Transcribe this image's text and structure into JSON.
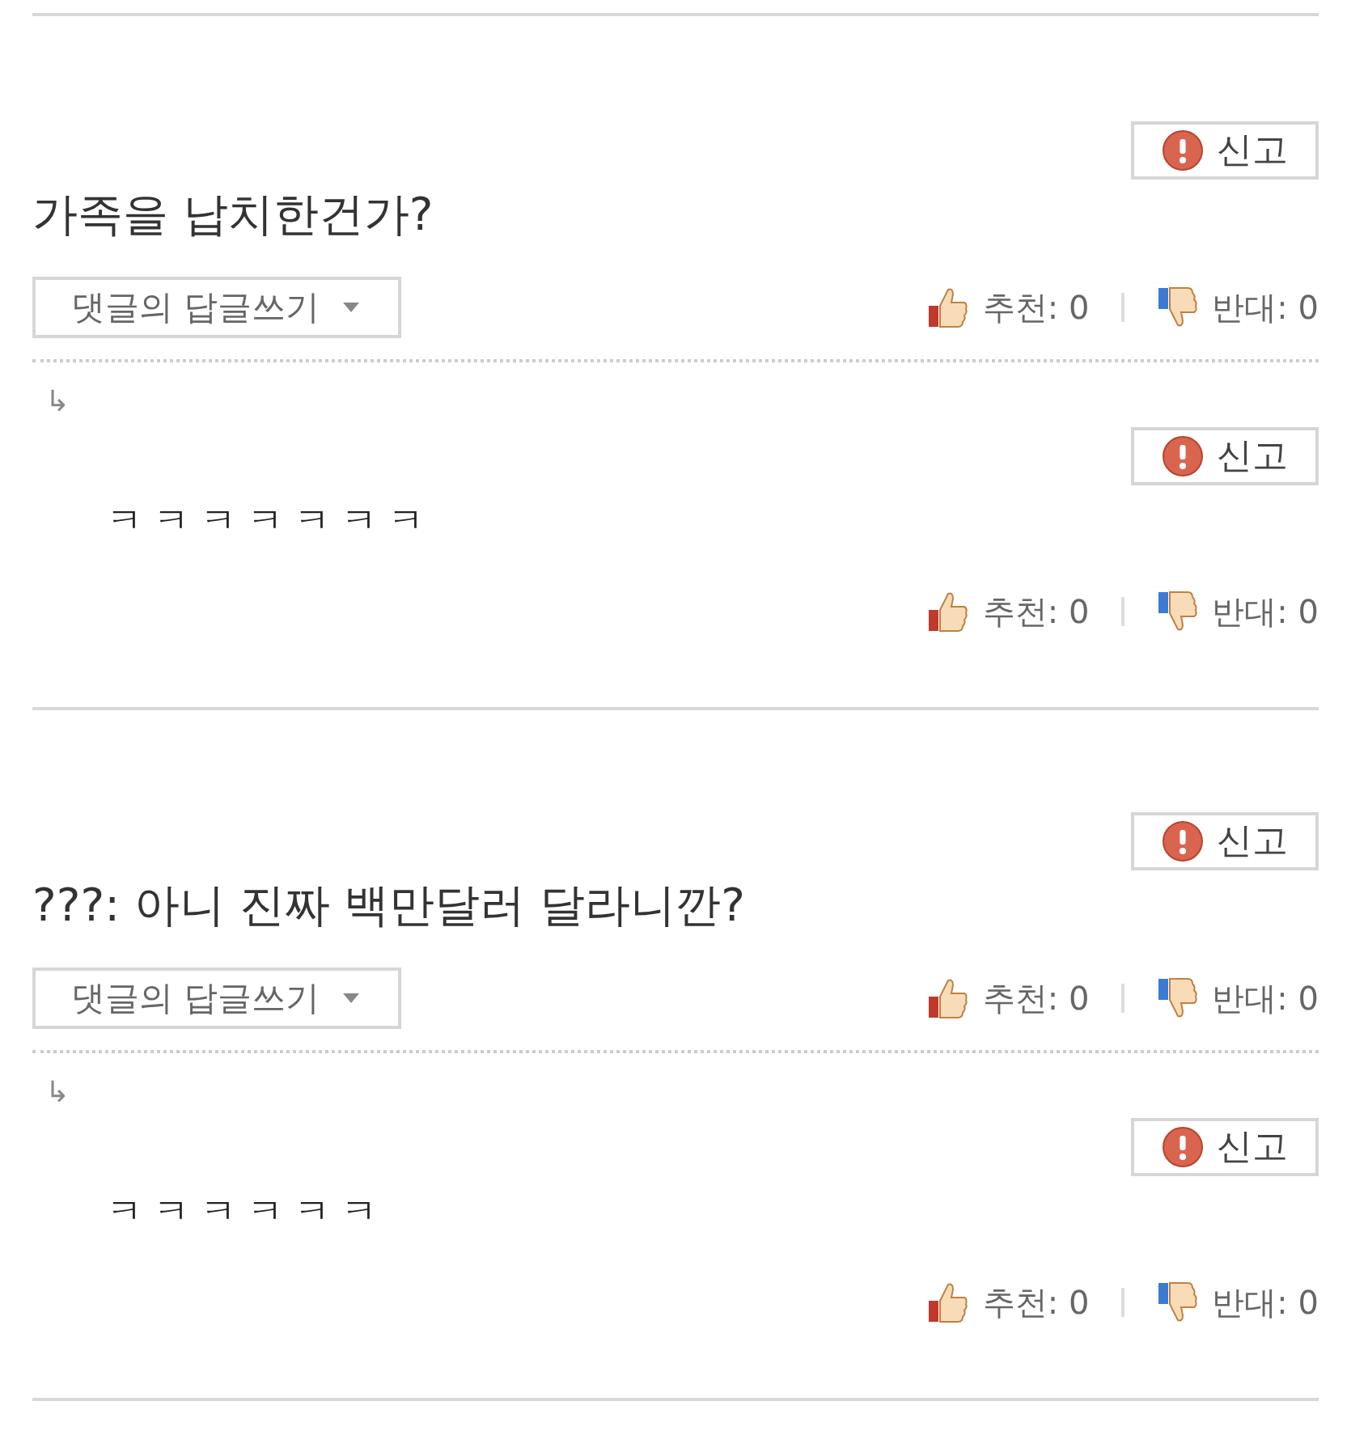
{
  "threads": [
    {
      "comment": {
        "report": "신고",
        "text": "가족을 납치한건가?",
        "reply_button": "댓글의 답글쓰기",
        "upvote": "추천: 0",
        "downvote": "반대: 0"
      },
      "replies": [
        {
          "arrow": "↳",
          "report": "신고",
          "text": "ㅋ ㅋ ㅋ ㅋ ㅋ ㅋ ㅋ",
          "upvote": "추천: 0",
          "downvote": "반대: 0"
        }
      ]
    },
    {
      "comment": {
        "report": "신고",
        "text": "???: 아니 진짜 백만달러 달라니깐?",
        "reply_button": "댓글의 답글쓰기",
        "upvote": "추천: 0",
        "downvote": "반대: 0"
      },
      "replies": [
        {
          "arrow": "↳",
          "report": "신고",
          "text": "ㅋ ㅋ ㅋ ㅋ ㅋ ㅋ",
          "upvote": "추천: 0",
          "downvote": "반대: 0"
        }
      ]
    }
  ]
}
